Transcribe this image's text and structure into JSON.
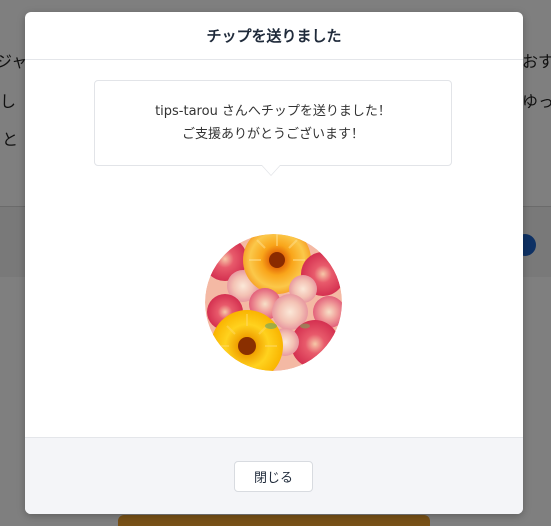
{
  "modal": {
    "title": "チップを送りました",
    "message_line1": "tips-tarou さんへチップを送りました！",
    "message_line2": "ご支援ありがとうございます！",
    "avatar_icon": "flower-bouquet-image",
    "close_label": "閉じる"
  },
  "background": {
    "left_fragments": [
      "ジャ",
      "し",
      "と"
    ],
    "right_fragments": [
      "おす",
      "ゆっ"
    ]
  },
  "colors": {
    "overlay": "rgba(0,0,0,0.5)",
    "title": "#1f2a3a",
    "footer_bg": "#f4f5f8",
    "bg_accent_blue": "#1d63c9",
    "bg_accent_orange": "#f0a22f"
  }
}
